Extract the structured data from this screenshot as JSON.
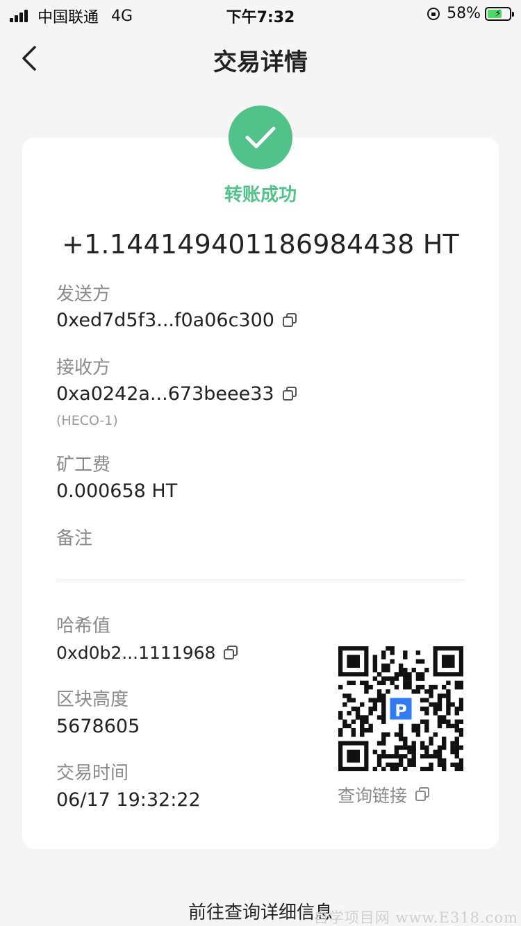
{
  "status_bar": {
    "carrier": "中国联通",
    "network": "4G",
    "time": "下午7:32",
    "battery": "58%"
  },
  "nav": {
    "title": "交易详情"
  },
  "card": {
    "status": "转账成功",
    "amount": "+1.14414940118698443​8 HT",
    "sender": {
      "label": "发送方",
      "value": "0xed7d5f3...f0a06c300"
    },
    "receiver": {
      "label": "接收方",
      "value": "0xa0242a...673beee33",
      "network": "(HECO-1)"
    },
    "fee": {
      "label": "矿工费",
      "value": "0.000658 HT"
    },
    "memo": {
      "label": "备注"
    },
    "hash": {
      "label": "哈希值",
      "value": "0xd0b2...1111968"
    },
    "block": {
      "label": "区块高度",
      "value": "5678605"
    },
    "time": {
      "label": "交易时间",
      "value": "06/17 19:32:22"
    },
    "qr_label": "查询链接"
  },
  "footer": {
    "link": "前往查询详细信息",
    "watermark": "自学项目网 www.E318.com"
  },
  "colors": {
    "accent": "#52c28b",
    "background": "#f5f5f5"
  }
}
